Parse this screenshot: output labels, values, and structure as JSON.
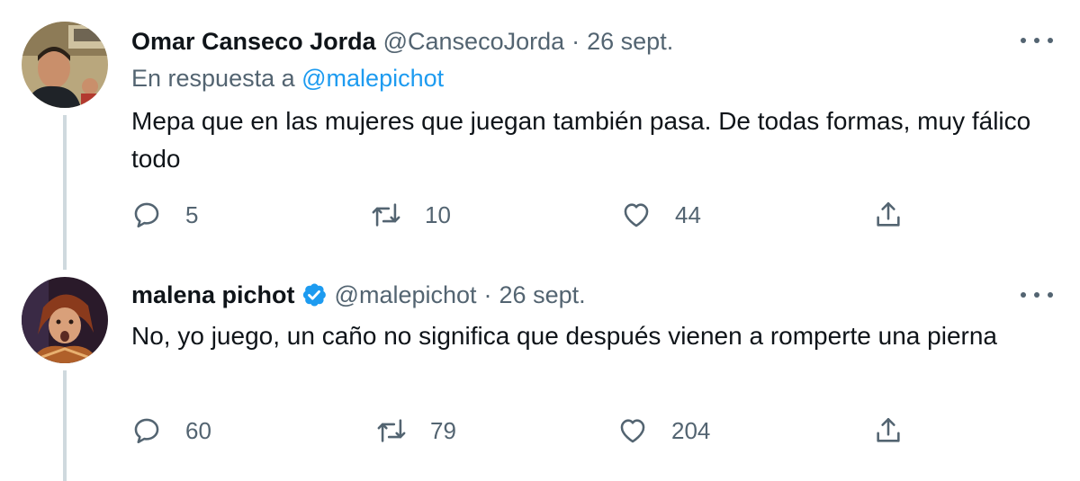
{
  "tweets": [
    {
      "name": "Omar Canseco Jorda",
      "handle": "@CansecoJorda",
      "separator": "·",
      "date": "26 sept.",
      "reply_prefix": "En respuesta a",
      "reply_mention": "@malepichot",
      "text": "Mepa que en las mujeres que juegan también pasa. De todas formas, muy fálico todo",
      "replies": "5",
      "retweets": "10",
      "likes": "44",
      "verified": false
    },
    {
      "name": "malena pichot",
      "handle": "@malepichot",
      "separator": "·",
      "date": "26 sept.",
      "text": "No, yo juego, un caño no significa que después vienen a romperte una pierna",
      "replies": "60",
      "retweets": "79",
      "likes": "204",
      "verified": true
    }
  ],
  "icons": {
    "reply": "reply-icon",
    "retweet": "retweet-icon",
    "like": "heart-icon",
    "share": "share-icon",
    "more": "more-icon",
    "verified": "verified-badge-icon"
  },
  "colors": {
    "link": "#1d9bf0",
    "secondary_text": "#536471",
    "thread_line": "#cfd9de",
    "primary_text": "#0f1419"
  }
}
